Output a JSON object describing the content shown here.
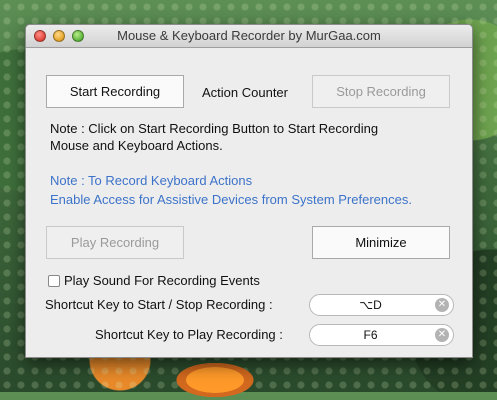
{
  "window": {
    "title": "Mouse & Keyboard Recorder by MurGaa.com"
  },
  "buttons": {
    "start_recording": "Start Recording",
    "stop_recording": "Stop Recording",
    "play_recording": "Play Recording",
    "minimize": "Minimize"
  },
  "action_counter_label": "Action Counter",
  "notes": {
    "line1": "Note : Click on Start Recording Button to Start Recording",
    "line2": "Mouse and Keyboard Actions.",
    "blue_line1": "Note : To Record Keyboard Actions",
    "blue_line2": "Enable Access for Assistive Devices from System Preferences."
  },
  "play_sound": {
    "label": "Play Sound For Recording Events",
    "checked": false
  },
  "shortcuts": {
    "start_stop_label": "Shortcut Key to Start / Stop Recording :",
    "start_stop_value": "⌥D",
    "play_label": "Shortcut Key to Play Recording :",
    "play_value": "F6"
  },
  "colors": {
    "blue_note": "#3d73c9",
    "disabled_text": "#9a9a9a"
  },
  "icons": {
    "clear": "x-circle"
  }
}
